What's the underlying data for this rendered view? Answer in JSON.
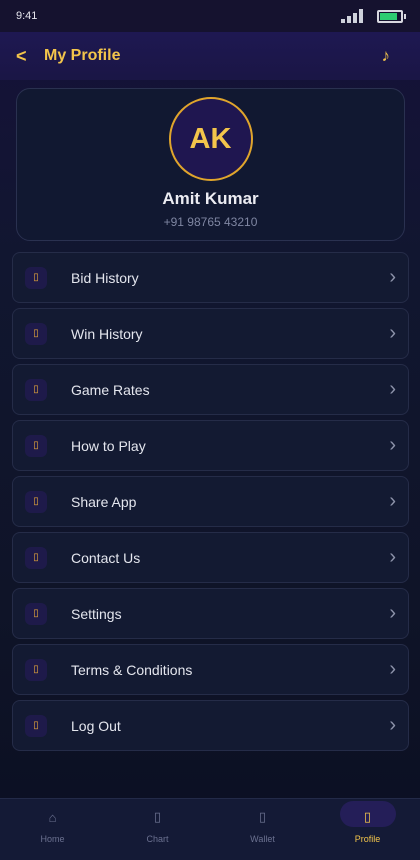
{
  "status_bar": {
    "time": "9:41"
  },
  "header": {
    "back_glyph": "<",
    "title": "My Profile",
    "music_glyph": "♪"
  },
  "profile": {
    "initials": "AK",
    "name": "Amit Kumar",
    "phone": "+91 98765 43210"
  },
  "menu": {
    "icon_glyph": "▯",
    "chevron_glyph": "›",
    "items": [
      {
        "label": "Bid History",
        "icon": "bid-history-icon"
      },
      {
        "label": "Win History",
        "icon": "win-history-icon"
      },
      {
        "label": "Game Rates",
        "icon": "game-rates-icon"
      },
      {
        "label": "How to Play",
        "icon": "how-to-play-icon"
      },
      {
        "label": "Share App",
        "icon": "share-icon"
      },
      {
        "label": "Contact Us",
        "icon": "contact-icon"
      },
      {
        "label": "Settings",
        "icon": "settings-icon"
      },
      {
        "label": "Terms & Conditions",
        "icon": "terms-icon"
      },
      {
        "label": "Log Out",
        "icon": "logout-icon"
      }
    ]
  },
  "bottom_nav": {
    "items": [
      {
        "label": "Home",
        "glyph": "⌂",
        "active": false
      },
      {
        "label": "Chart",
        "glyph": "▯",
        "active": false
      },
      {
        "label": "Wallet",
        "glyph": "▯",
        "active": false
      },
      {
        "label": "Profile",
        "glyph": "▯",
        "active": true
      }
    ]
  },
  "colors": {
    "accent": "#f3c54b",
    "battery": "#2ecc71",
    "background": "#111630"
  }
}
